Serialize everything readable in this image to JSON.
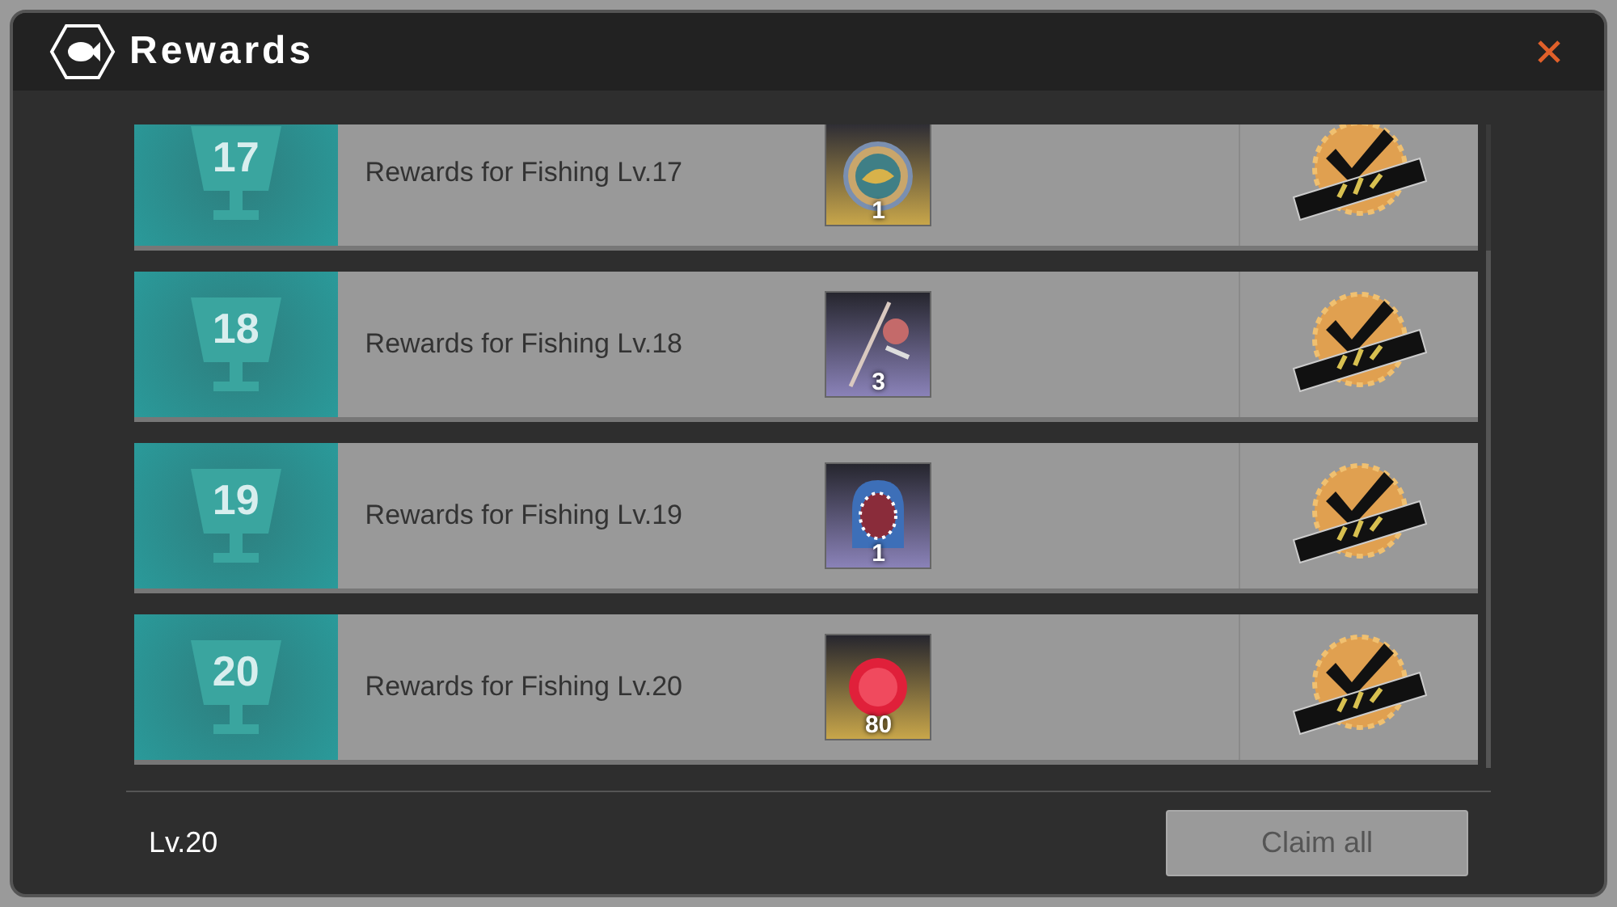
{
  "window": {
    "title": "Rewards"
  },
  "rewards": [
    {
      "level": "17",
      "label": "Rewards for Fishing Lv.17",
      "item": {
        "kind": "medal",
        "quantity": "1"
      },
      "claimed": true
    },
    {
      "level": "18",
      "label": "Rewards for Fishing Lv.18",
      "item": {
        "kind": "rod",
        "quantity": "3"
      },
      "claimed": true
    },
    {
      "level": "19",
      "label": "Rewards for Fishing Lv.19",
      "item": {
        "kind": "hat",
        "quantity": "1"
      },
      "claimed": true
    },
    {
      "level": "20",
      "label": "Rewards for Fishing Lv.20",
      "item": {
        "kind": "gem",
        "quantity": "80"
      },
      "claimed": true
    }
  ],
  "footer": {
    "level": "Lv.20",
    "claim_all": {
      "label": "Claim all",
      "disabled": true
    }
  }
}
